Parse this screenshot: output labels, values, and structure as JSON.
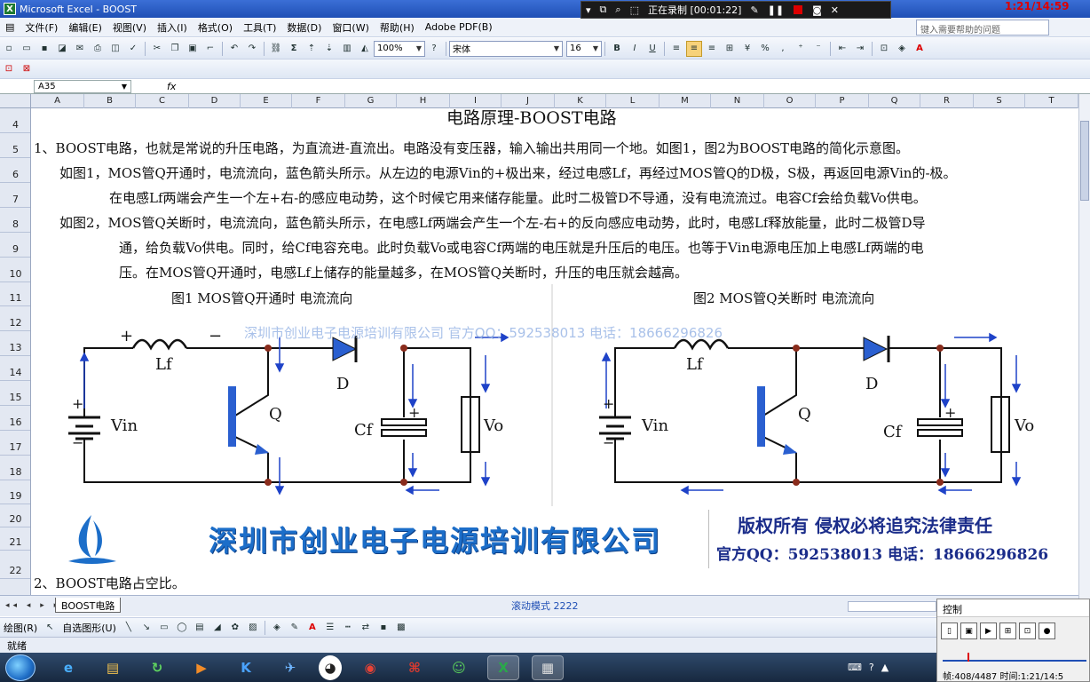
{
  "window": {
    "title": "Microsoft Excel - BOOST"
  },
  "recorder": {
    "status": "正在录制 [00:01:22]",
    "clock": "1:21/14:59"
  },
  "menu": [
    "文件(F)",
    "编辑(E)",
    "视图(V)",
    "插入(I)",
    "格式(O)",
    "工具(T)",
    "数据(D)",
    "窗口(W)",
    "帮助(H)",
    "Adobe PDF(B)"
  ],
  "help_placeholder": "键入需要帮助的问题",
  "toolbar": {
    "zoom": "100%",
    "font": "宋体",
    "font_size": "16",
    "bold": "B",
    "italic": "I",
    "underline": "U",
    "percent": "%"
  },
  "namebox": "A35",
  "fx_label": "fx",
  "columns": [
    "A",
    "B",
    "C",
    "D",
    "E",
    "F",
    "G",
    "H",
    "I",
    "J",
    "K",
    "L",
    "M",
    "N",
    "O",
    "P",
    "Q",
    "R",
    "S",
    "T"
  ],
  "rows": [
    "4",
    "5",
    "6",
    "7",
    "8",
    "9",
    "10",
    "11",
    "12",
    "13",
    "14",
    "15",
    "16",
    "17",
    "18",
    "19",
    "20",
    "21",
    "22"
  ],
  "doc": {
    "title": "电路原理-BOOST电路",
    "lines": [
      "1、BOOST电路，也就是常说的升压电路，为直流进-直流出。电路没有变压器，输入输出共用同一个地。如图1，图2为BOOST电路的简化示意图。",
      "如图1，MOS管Q开通时，电流流向，蓝色箭头所示。从左边的电源Vin的+极出来，经过电感Lf，再经过MOS管Q的D极，S极，再返回电源Vin的-极。",
      "在电感Lf两端会产生一个左+右-的感应电动势，这个时候它用来储存能量。此时二极管D不导通，没有电流流过。电容Cf会给负载Vo供电。",
      "如图2，MOS管Q关断时，电流流向，蓝色箭头所示，在电感Lf两端会产生一个左-右+的反向感应电动势，此时，电感Lf释放能量，此时二极管D导",
      "通，给负载Vo供电。同时，给Cf电容充电。此时负载Vo或电容Cf两端的电压就是升压后的电压。也等于Vin电源电压加上电感Lf两端的电",
      "压。在MOS管Q开通时，电感Lf上储存的能量越多，在MOS管Q关断时，升压的电压就会越高。"
    ],
    "fig1_caption": "图1 MOS管Q开通时 电流流向",
    "fig2_caption": "图2 MOS管Q关断时 电流流向",
    "watermark": "深圳市创业电子电源培训有限公司 官方QQ：592538013 电话：18666296826",
    "section2": "2、BOOST电路占空比。"
  },
  "circuit_labels": {
    "lf": "Lf",
    "vin": "Vin",
    "q": "Q",
    "d": "D",
    "cf": "Cf",
    "vo": "Vo",
    "plus": "+",
    "minus": "−"
  },
  "banner": {
    "company": "深圳市创业电子电源培训有限公司",
    "copyright": "版权所有 侵权必将追究法律责任",
    "contact": "官方QQ：592538013 电话：18666296826"
  },
  "sheet_tab": "BOOST电路",
  "hscroll_mode": "滚动模式 2222",
  "drawbar": {
    "draw": "绘图(R)",
    "autoshape": "自选图形(U)"
  },
  "status": "就绪",
  "control_panel": {
    "title": "控制",
    "info": "帧:408/4487 时间:1:21/14:5"
  }
}
